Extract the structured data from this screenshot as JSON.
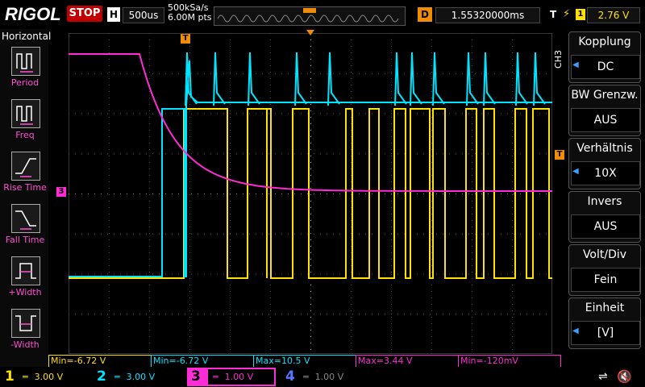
{
  "header": {
    "brand": "RIGOL",
    "run_state": "STOP",
    "horizontal_badge": "H",
    "timebase": "500us",
    "sample_rate": "500kSa/s",
    "memory_depth": "6.00M pts",
    "delay_badge": "D",
    "delay": "1.55320000ms",
    "trigger_badge": "T",
    "trigger_source": "1",
    "trigger_level": "2.76 V"
  },
  "left_menu": {
    "title": "Horizontal",
    "items": [
      {
        "label": "Period",
        "icon": "period-icon"
      },
      {
        "label": "Freq",
        "icon": "freq-icon"
      },
      {
        "label": "Rise Time",
        "icon": "rise-time-icon"
      },
      {
        "label": "Fall Time",
        "icon": "fall-time-icon"
      },
      {
        "label": "+Width",
        "icon": "pos-width-icon"
      },
      {
        "label": "-Width",
        "icon": "neg-width-icon"
      }
    ]
  },
  "right_menu": {
    "channel_tag": "CH3",
    "items": [
      {
        "title": "Kopplung",
        "value": "DC"
      },
      {
        "title": "BW Grenzw.",
        "value": "AUS"
      },
      {
        "title": "Verhältnis",
        "value": "10X"
      },
      {
        "title": "Invers",
        "value": "AUS"
      },
      {
        "title": "Volt/Div",
        "value": "Fein"
      },
      {
        "title": "Einheit",
        "value": "[V]"
      }
    ]
  },
  "measurements": [
    {
      "text": "Min=-6.72 V",
      "color": "#ffe000"
    },
    {
      "text": "Min=-6.72 V",
      "color": "#00e5ff"
    },
    {
      "text": "Max=10.5 V",
      "color": "#00e5ff"
    },
    {
      "text": "Max=3.44 V",
      "color": "#ff2bd6"
    },
    {
      "text": "Min=-120mV",
      "color": "#ff2bd6"
    }
  ],
  "channels": [
    {
      "num": "1",
      "scale": "3.00 V",
      "color": "#ffe000"
    },
    {
      "num": "2",
      "scale": "3.00 V",
      "color": "#00e5ff"
    },
    {
      "num": "3",
      "scale": "1.00 V",
      "color": "#ff2bd6"
    },
    {
      "num": "4",
      "scale": "1.00 V",
      "color": "#5577ff"
    }
  ],
  "markers": {
    "trigger_top": "T",
    "ch3_ground": "3",
    "trigger_level_marker": "T"
  },
  "colors": {
    "ch1": "#ffe000",
    "ch2": "#00e5ff",
    "ch3": "#ff2bd6",
    "trigger": "#f08c00"
  }
}
